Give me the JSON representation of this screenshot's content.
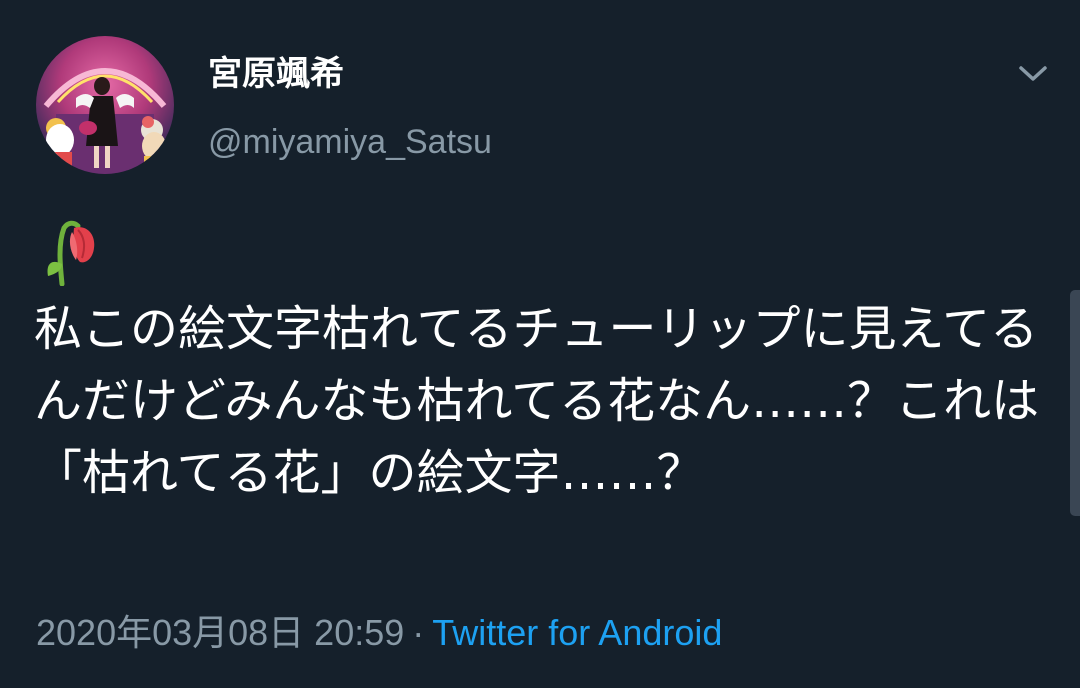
{
  "tweet": {
    "display_name": "宮原颯希",
    "handle": "@miyamiya_Satsu",
    "emoji": "wilted-flower",
    "text": "私この絵文字枯れてるチューリップに見えてるんだけどみんなも枯れてる花なん……？これは「枯れてる花」の絵文字……？",
    "timestamp": "2020年03月08日 20:59",
    "separator": "·",
    "source": "Twitter for Android"
  },
  "colors": {
    "background": "#15202b",
    "primary_text": "#ffffff",
    "secondary_text": "#8899a6",
    "link": "#1da1f2"
  },
  "icons": {
    "caret": "chevron-down-icon",
    "emoji": "wilted-flower-icon"
  }
}
